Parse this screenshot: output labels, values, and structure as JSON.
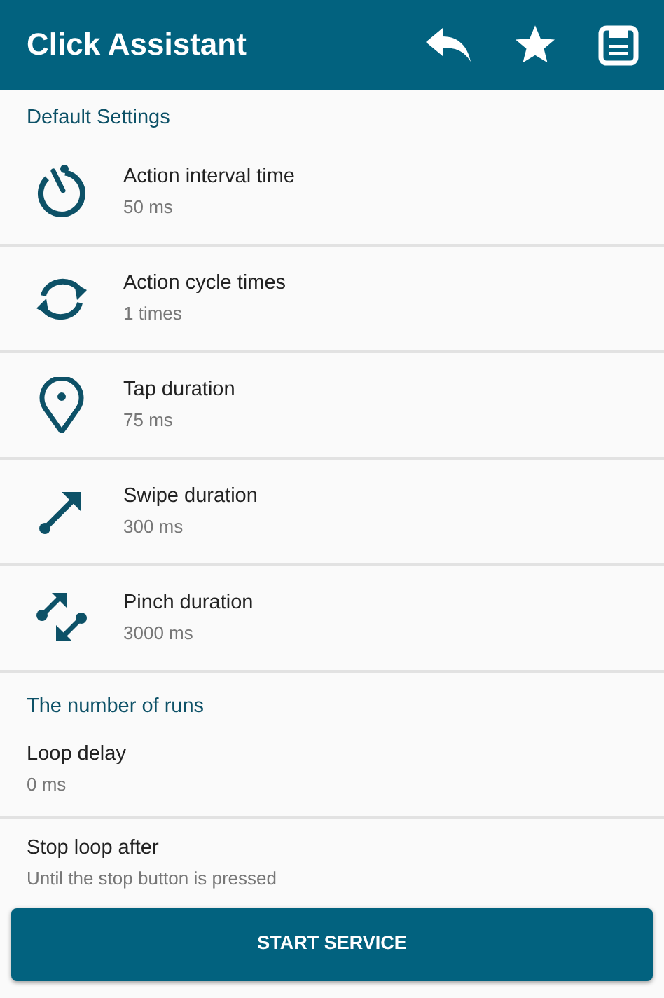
{
  "app_bar": {
    "title": "Click Assistant"
  },
  "sections": [
    {
      "title": "Default Settings",
      "items": [
        {
          "kind": "icon",
          "title": "Action interval time",
          "value": "50 ms"
        },
        {
          "kind": "icon",
          "title": "Action cycle times",
          "value": "1 times"
        },
        {
          "kind": "icon",
          "title": "Tap duration",
          "value": "75 ms"
        },
        {
          "kind": "icon",
          "title": "Swipe duration",
          "value": "300 ms"
        },
        {
          "kind": "icon",
          "title": "Pinch duration",
          "value": "3000 ms"
        }
      ]
    },
    {
      "title": "The number of runs",
      "items": [
        {
          "kind": "plain",
          "title": "Loop delay",
          "value": "0 ms"
        },
        {
          "kind": "plain",
          "title": "Stop loop after",
          "value": "Until the stop button is pressed"
        }
      ]
    }
  ],
  "primary_button": "START SERVICE"
}
